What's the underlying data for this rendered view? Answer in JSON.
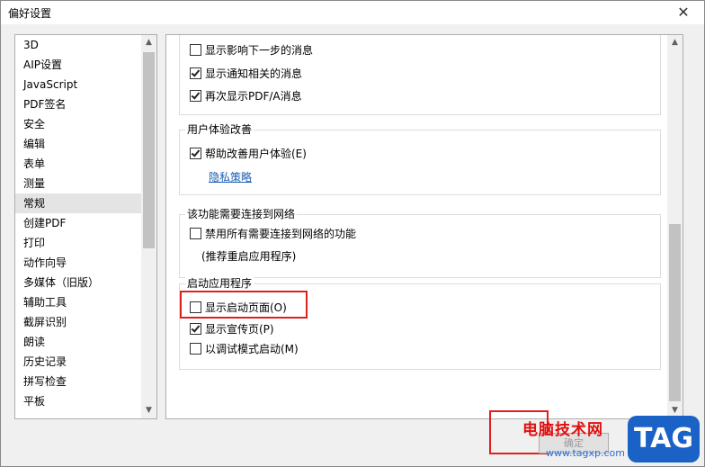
{
  "window": {
    "title": "偏好设置",
    "close_glyph": "✕"
  },
  "sidebar": {
    "items": [
      "3D",
      "AIP设置",
      "JavaScript",
      "PDF签名",
      "安全",
      "编辑",
      "表单",
      "测量",
      "常规",
      "创建PDF",
      "打印",
      "动作向导",
      "多媒体（旧版）",
      "辅助工具",
      "截屏识别",
      "朗读",
      "历史记录",
      "拼写检查",
      "平板",
      "..."
    ],
    "selected_index": 8
  },
  "content": {
    "group_messages": {
      "options": [
        {
          "label": "显示影响下一步的消息",
          "checked": false
        },
        {
          "label": "显示通知相关的消息",
          "checked": true
        },
        {
          "label": "再次显示PDF/A消息",
          "checked": true
        }
      ]
    },
    "group_ux": {
      "title": "用户体验改善",
      "options": [
        {
          "label": "帮助改善用户体验(E)",
          "checked": true
        }
      ],
      "link": "隐私策略"
    },
    "group_network": {
      "title": "该功能需要连接到网络",
      "options": [
        {
          "label": "禁用所有需要连接到网络的功能",
          "checked": false
        }
      ],
      "note": "(推荐重启应用程序)"
    },
    "group_startup": {
      "title": "启动应用程序",
      "options": [
        {
          "label": "显示启动页面(O)",
          "checked": false
        },
        {
          "label": "显示宣传页(P)",
          "checked": true
        },
        {
          "label": "以调试模式启动(M)",
          "checked": false
        }
      ]
    }
  },
  "footer": {
    "ok_label": "确定"
  },
  "watermark": {
    "text": "电脑技术网",
    "url": "www.tagxp.com",
    "badge": "TAG"
  },
  "colors": {
    "highlight": "#e0201f",
    "link": "#1a5fb4",
    "badge": "#1a62c6"
  }
}
